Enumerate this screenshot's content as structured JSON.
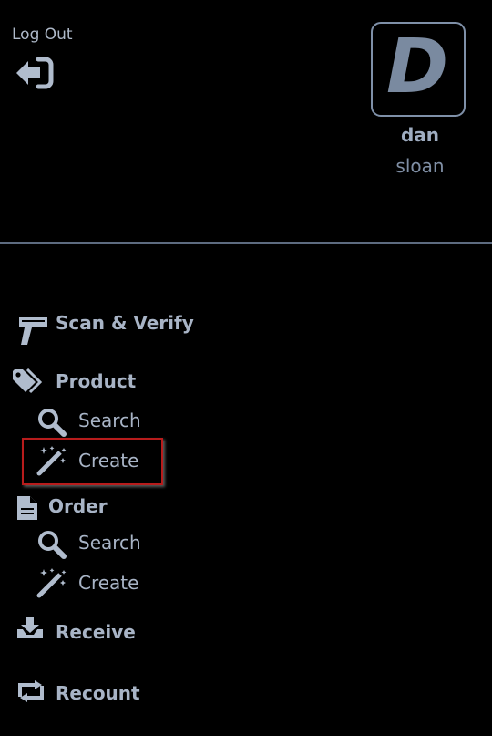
{
  "header": {
    "logout_label": "Log Out",
    "logout_icon": "sign-out-icon"
  },
  "user": {
    "avatar_letter": "D",
    "first_name": "dan",
    "last_name": "sloan"
  },
  "nav": {
    "scan_verify": {
      "label": "Scan & Verify",
      "icon": "barcode-scanner-icon"
    },
    "product": {
      "label": "Product",
      "icon": "tags-icon",
      "search": {
        "label": "Search",
        "icon": "search-icon"
      },
      "create": {
        "label": "Create",
        "icon": "magic-wand-icon"
      }
    },
    "order": {
      "label": "Order",
      "icon": "file-icon",
      "search": {
        "label": "Search",
        "icon": "search-icon"
      },
      "create": {
        "label": "Create",
        "icon": "magic-wand-icon"
      }
    },
    "receive": {
      "label": "Receive",
      "icon": "inbox-download-icon"
    },
    "recount": {
      "label": "Recount",
      "icon": "retweet-icon"
    }
  },
  "colors": {
    "background": "#000000",
    "text": "#a8b4c6",
    "icon": "#b0bccd",
    "divider": "#5d6b80",
    "highlight_border": "#b81c1c"
  }
}
